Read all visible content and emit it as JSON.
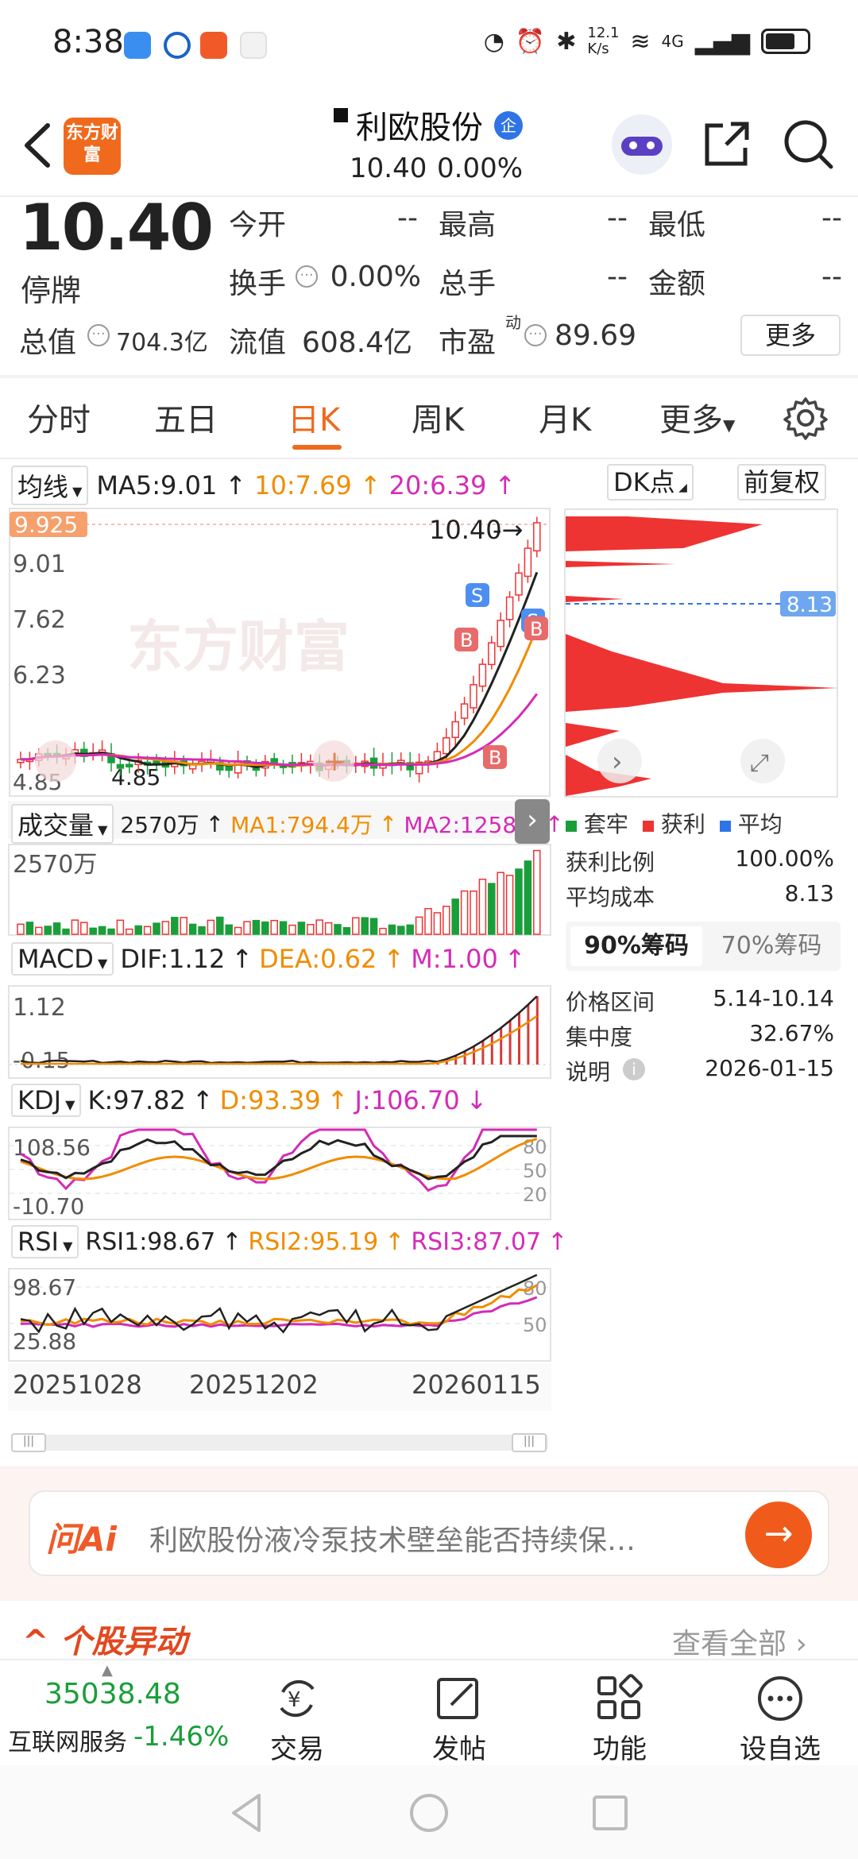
{
  "status_bar": {
    "time": "8:38",
    "net_speed": "12.1\nK/s",
    "network": "4G"
  },
  "header": {
    "stock_name": "利欧股份",
    "badge": "企",
    "price": "10.40",
    "change": "0.00%",
    "logo_text": "东方财富"
  },
  "quote": {
    "price": "10.40",
    "state": "停牌",
    "fields": [
      {
        "label": "今开",
        "value": "--"
      },
      {
        "label": "最高",
        "value": "--"
      },
      {
        "label": "最低",
        "value": "--"
      },
      {
        "label": "换手",
        "value": "0.00%"
      },
      {
        "label": "总手",
        "value": "--"
      },
      {
        "label": "金额",
        "value": "--"
      }
    ],
    "total_value_label": "总值",
    "total_value": "704.3亿",
    "float_value_label": "流值",
    "float_value": "608.4亿",
    "pe_label": "市盈",
    "pe_sup": "动",
    "pe_value": "89.69",
    "more": "更多"
  },
  "tabs": [
    "分时",
    "五日",
    "日K",
    "周K",
    "月K",
    "更多"
  ],
  "active_tab": "日K",
  "ma_row": {
    "dropdown": "均线",
    "ma5": "MA5:9.01",
    "ma10": "10:7.69",
    "ma20": "20:6.39",
    "dk": "DK点",
    "adjust": "前复权"
  },
  "kline": {
    "y_ticks": [
      "9.925",
      "9.01",
      "7.62",
      "6.23",
      "4.85"
    ],
    "last_price_label": "10.40",
    "low_label": "4.85",
    "watermark": "东方财富",
    "markers": [
      "S",
      "B",
      "B",
      "S",
      "B"
    ]
  },
  "chips": {
    "avg_label": "8.13",
    "legend": [
      "套牢",
      "获利",
      "平均"
    ],
    "legend_colors": [
      "#1a9e3a",
      "#e33",
      "#2f74e6"
    ],
    "stats": [
      {
        "label": "获利比例",
        "value": "100.00%"
      },
      {
        "label": "平均成本",
        "value": "8.13"
      }
    ],
    "tabs": [
      "90%筹码",
      "70%筹码"
    ],
    "stats2": [
      {
        "label": "价格区间",
        "value": "5.14-10.14"
      },
      {
        "label": "集中度",
        "value": "32.67%"
      },
      {
        "label": "说明",
        "value": "2026-01-15"
      }
    ]
  },
  "volume": {
    "dropdown": "成交量",
    "vol": "2570万",
    "ma1": "MA1:794.4万",
    "ma2": "MA2:1258万",
    "y_tick": "2570万"
  },
  "macd": {
    "dropdown": "MACD",
    "dif": "DIF:1.12",
    "dea": "DEA:0.62",
    "m": "M:1.00",
    "ticks": [
      "1.12",
      "-0.15"
    ]
  },
  "kdj": {
    "dropdown": "KDJ",
    "k": "K:97.82",
    "d": "D:93.39",
    "j": "J:106.70",
    "ticks": [
      "108.56",
      "-10.70"
    ],
    "levels": [
      "80",
      "50",
      "20"
    ]
  },
  "rsi": {
    "dropdown": "RSI",
    "rsi1": "RSI1:98.67",
    "rsi2": "RSI2:95.19",
    "rsi3": "RSI3:87.07",
    "ticks": [
      "98.67",
      "25.88"
    ],
    "levels": [
      "80",
      "50"
    ]
  },
  "x_dates": [
    "20251028",
    "20251202",
    "20260115"
  ],
  "ask_ai": {
    "logo": "问Ai",
    "placeholder": "利欧股份液冷泵技术壁垒能否持续保…"
  },
  "section": {
    "title": "个股异动",
    "link": "查看全部"
  },
  "bottom_nav": {
    "index_value": "35038.48",
    "index_name": "互联网服务",
    "index_change": "-1.46%",
    "items": [
      "交易",
      "发帖",
      "功能",
      "设自选"
    ]
  },
  "colors": {
    "accent": "#ef6a1d",
    "up": "#e33",
    "down": "#1a9e3a",
    "ma10": "#f08c00",
    "ma20": "#d42bb7"
  }
}
